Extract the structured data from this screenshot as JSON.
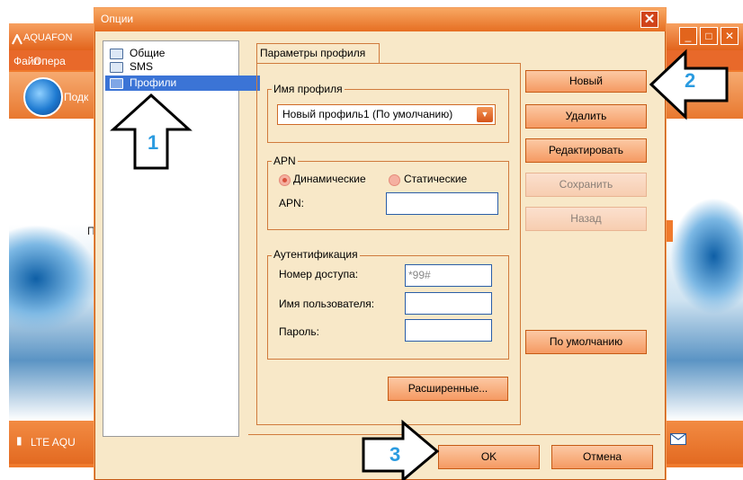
{
  "background_app": {
    "title": "AQUAFON",
    "menu_file": "Файл",
    "menu_operations": "Опера",
    "connect_label": "Подк",
    "mid_text": "П",
    "status_label": "LTE AQU"
  },
  "dialog": {
    "title": "Опции",
    "close_glyph": "✕"
  },
  "tree": {
    "items": [
      {
        "label": "Общие"
      },
      {
        "label": "SMS"
      },
      {
        "label": "Профили",
        "selected": true
      }
    ]
  },
  "tab": {
    "label": "Параметры профиля"
  },
  "profile_name": {
    "legend": "Имя профиля",
    "selected_value": "Новый профиль1 (По умолчанию)"
  },
  "apn": {
    "legend": "APN",
    "radio_dynamic": "Динамические",
    "radio_static": "Статические",
    "selected": "Динамические",
    "apn_label": "APN:",
    "apn_value": ""
  },
  "auth": {
    "legend": "Аутентификация",
    "number_label": "Номер доступа:",
    "number_value": "*99#",
    "user_label": "Имя пользователя:",
    "user_value": "",
    "password_label": "Пароль:",
    "password_value": ""
  },
  "buttons": {
    "advanced": "Расширенные...",
    "new": "Новый",
    "delete": "Удалить",
    "edit": "Редактировать",
    "save": "Сохранить",
    "back": "Назад",
    "default": "По умолчанию",
    "ok": "OK",
    "cancel": "Отмена"
  },
  "annotations": {
    "step1": "1",
    "step2": "2",
    "step3": "3"
  },
  "colors": {
    "accent": "#e66e22",
    "dialog_bg": "#f8e8c8",
    "selection": "#3b74d6",
    "annotation_number": "#2a9be0"
  }
}
